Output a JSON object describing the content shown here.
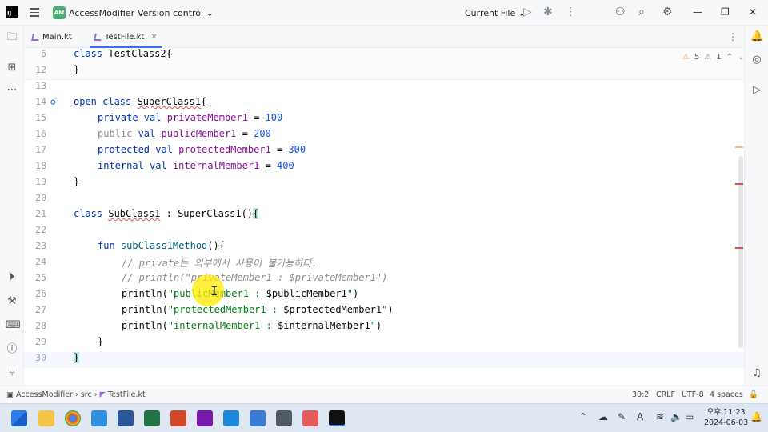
{
  "titlebar": {
    "project_badge": "AM",
    "project_name": "AccessModifier",
    "vcs_label": "Version control",
    "run_config": "Current File"
  },
  "tabs": [
    {
      "label": "Main.kt"
    },
    {
      "label": "TestFile.kt"
    }
  ],
  "inspections": {
    "warnings": "5",
    "weak": "1"
  },
  "gutter": [
    "6",
    "12",
    "13",
    "14",
    "15",
    "16",
    "17",
    "18",
    "19",
    "20",
    "21",
    "22",
    "23",
    "24",
    "25",
    "26",
    "27",
    "28",
    "29",
    "30"
  ],
  "code": {
    "l6": [
      "class ",
      "TestClass2",
      "{"
    ],
    "l12": "}",
    "l14": [
      "open ",
      "class ",
      "SuperClass1",
      "{"
    ],
    "l15": [
      "private ",
      "val ",
      "privateMember1",
      " = ",
      "100"
    ],
    "l16": [
      "public ",
      "val ",
      "publicMember1",
      " = ",
      "200"
    ],
    "l17": [
      "protected ",
      "val ",
      "protectedMember1",
      " = ",
      "300"
    ],
    "l18": [
      "internal ",
      "val ",
      "internalMember1",
      " = ",
      "400"
    ],
    "l19": "}",
    "l21": [
      "class ",
      "SubClass1",
      " : ",
      "SuperClass1",
      "()",
      "{"
    ],
    "l23": [
      "fun ",
      "subClass1Method",
      "(){"
    ],
    "l24": "// private는 외부에서 사용이 불가능하다.",
    "l25": "// println(\"privateMember1 : $privateMember1\")",
    "l26": [
      "println(",
      "\"publicMember1 : ",
      "$publicMember1",
      "\"",
      ")"
    ],
    "l27": [
      "println(",
      "\"protectedMember1 : ",
      "$protectedMember1",
      "\"",
      ")"
    ],
    "l28": [
      "println(",
      "\"internalMember1 : ",
      "$internalMember1",
      "\"",
      ")"
    ],
    "l29": "}",
    "l30": "}"
  },
  "statusbar": {
    "breadcrumb": [
      "AccessModifier",
      "src",
      "TestFile.kt"
    ],
    "position": "30:2",
    "line_sep": "CRLF",
    "encoding": "UTF-8",
    "indent": "4 spaces"
  },
  "taskbar": {
    "time_period": "오후",
    "time": "11:23",
    "date": "2024-06-03",
    "ime": "A"
  },
  "colors": {
    "keyword": "#0033b3",
    "property": "#871094",
    "number": "#1750eb",
    "string": "#067d17",
    "comment": "#8c8c8c",
    "accent": "#3574f0"
  }
}
